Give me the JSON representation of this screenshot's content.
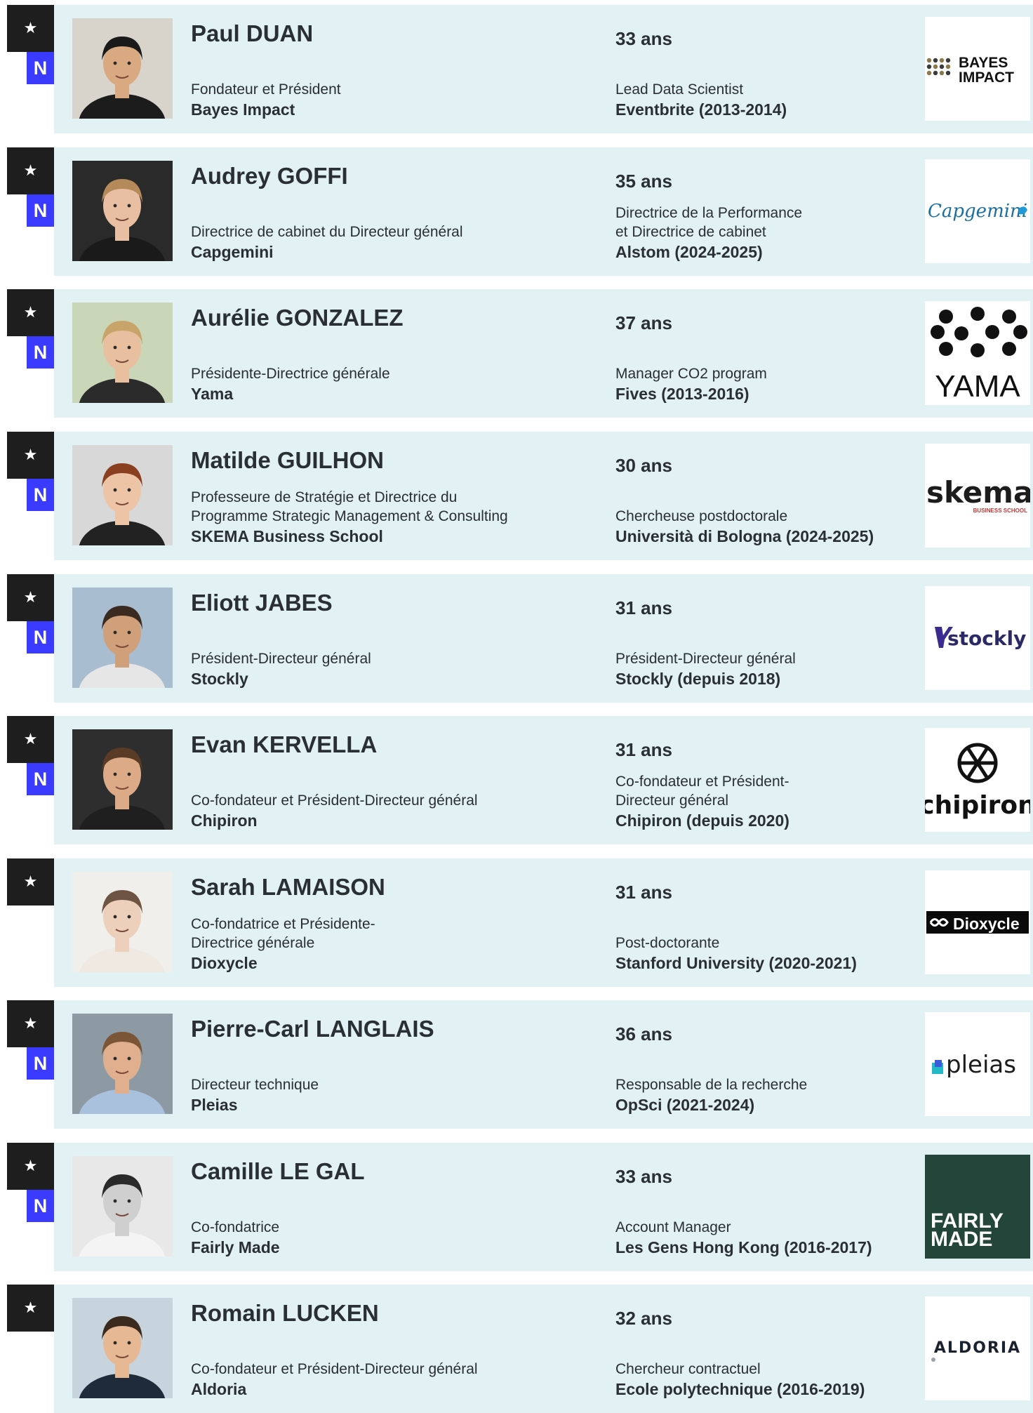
{
  "badges": {
    "star": "★",
    "new": "N"
  },
  "people": [
    {
      "name": "Paul DUAN",
      "age": "33 ans",
      "role": "Fondateur et Président",
      "company": "Bayes Impact",
      "prev_role": "Lead Data Scientist",
      "prev_company": "Eventbrite (2013-2014)",
      "is_new": true,
      "logo_text": "BAYES IMPACT",
      "logo_type": "bayes",
      "photo": {
        "bg": "#d8d4cc",
        "skin": "#d9a982",
        "hair": "#1a1a1a",
        "shirt": "#1c1c1c"
      }
    },
    {
      "name": "Audrey GOFFI",
      "age": "35 ans",
      "role": "Directrice de cabinet du Directeur général",
      "company": "Capgemini",
      "prev_role": "Directrice de la Performance\net Directrice de cabinet",
      "prev_company": "Alstom (2024-2025)",
      "is_new": true,
      "logo_text": "Capgemini",
      "logo_type": "capgemini",
      "photo": {
        "bg": "#2a2a2a",
        "skin": "#e8bfa2",
        "hair": "#b58a5a",
        "shirt": "#1a1a1a"
      }
    },
    {
      "name": "Aurélie GONZALEZ",
      "age": "37 ans",
      "role": "Présidente-Directrice générale",
      "company": "Yama",
      "prev_role": "Manager CO2 program",
      "prev_company": "Fives (2013-2016)",
      "is_new": true,
      "logo_text": "YAMA",
      "logo_type": "yama",
      "photo": {
        "bg": "#c9d6b8",
        "skin": "#e8c0a0",
        "hair": "#c9a46a",
        "shirt": "#2b2b2b"
      }
    },
    {
      "name": "Matilde GUILHON",
      "age": "30 ans",
      "role": "Professeure de Stratégie et Directrice du\nProgramme Strategic Management & Consulting",
      "company": "SKEMA Business School",
      "prev_role": "Chercheuse postdoctorale",
      "prev_company": "Università di Bologna (2024-2025)",
      "is_new": true,
      "logo_text": "skema",
      "logo_sub": "BUSINESS SCHOOL",
      "logo_type": "skema",
      "photo": {
        "bg": "#d8d8d8",
        "skin": "#eec4a6",
        "hair": "#8a3f20",
        "shirt": "#222222"
      }
    },
    {
      "name": "Eliott JABES",
      "age": "31 ans",
      "role": "Président-Directeur général",
      "company": "Stockly",
      "prev_role": "Président-Directeur général",
      "prev_company": "Stockly (depuis 2018)",
      "is_new": true,
      "logo_text": "stockly",
      "logo_type": "stockly",
      "photo": {
        "bg": "#a9bdd0",
        "skin": "#d0a07a",
        "hair": "#3a2a20",
        "shirt": "#e6e6e6"
      }
    },
    {
      "name": "Evan KERVELLA",
      "age": "31 ans",
      "role": "Co-fondateur et Président-Directeur général",
      "company": "Chipiron",
      "prev_role": "Co-fondateur et Président-\nDirecteur général",
      "prev_company": "Chipiron (depuis 2020)",
      "is_new": true,
      "logo_text": "chipiron",
      "logo_type": "chipiron",
      "photo": {
        "bg": "#2e2e2e",
        "skin": "#dcaa86",
        "hair": "#5a3b25",
        "shirt": "#1f1f1f"
      }
    },
    {
      "name": "Sarah LAMAISON",
      "age": "31 ans",
      "role": "Co-fondatrice et Présidente-\nDirectrice générale",
      "company": "Dioxycle",
      "prev_role": "Post-doctorante",
      "prev_company": "Stanford University (2020-2021)",
      "is_new": false,
      "logo_text": "Dioxycle",
      "logo_type": "dioxycle",
      "photo": {
        "bg": "#f1efec",
        "skin": "#ecd0bb",
        "hair": "#6e5442",
        "shirt": "#efe9e1"
      }
    },
    {
      "name": "Pierre-Carl LANGLAIS",
      "age": "36 ans",
      "role": "Directeur technique",
      "company": "Pleias",
      "prev_role": "Responsable de la recherche",
      "prev_company": "OpSci (2021-2024)",
      "is_new": true,
      "logo_text": "pleias",
      "logo_type": "pleias",
      "photo": {
        "bg": "#8d9aa3",
        "skin": "#e0b08e",
        "hair": "#7a5636",
        "shirt": "#a9c1dc"
      }
    },
    {
      "name": "Camille LE GAL",
      "age": "33 ans",
      "role": "Co-fondatrice",
      "company": "Fairly Made",
      "prev_role": "Account Manager",
      "prev_company": "Les Gens Hong Kong (2016-2017)",
      "is_new": true,
      "logo_text": "FAIRLY MADE",
      "logo_type": "fairly",
      "photo": {
        "bg": "#e8e8e8",
        "skin": "#cfcfcf",
        "hair": "#2a2a2a",
        "shirt": "#f4f4f4"
      }
    },
    {
      "name": "Romain LUCKEN",
      "age": "32 ans",
      "role": "Co-fondateur et Président-Directeur général",
      "company": "Aldoria",
      "prev_role": "Chercheur contractuel",
      "prev_company": "Ecole polytechnique (2016-2019)",
      "is_new": false,
      "logo_text": "ALDORIA",
      "logo_type": "aldoria",
      "photo": {
        "bg": "#c7d4de",
        "skin": "#e6b894",
        "hair": "#3b2a1e",
        "shirt": "#1f2a3a"
      }
    }
  ]
}
